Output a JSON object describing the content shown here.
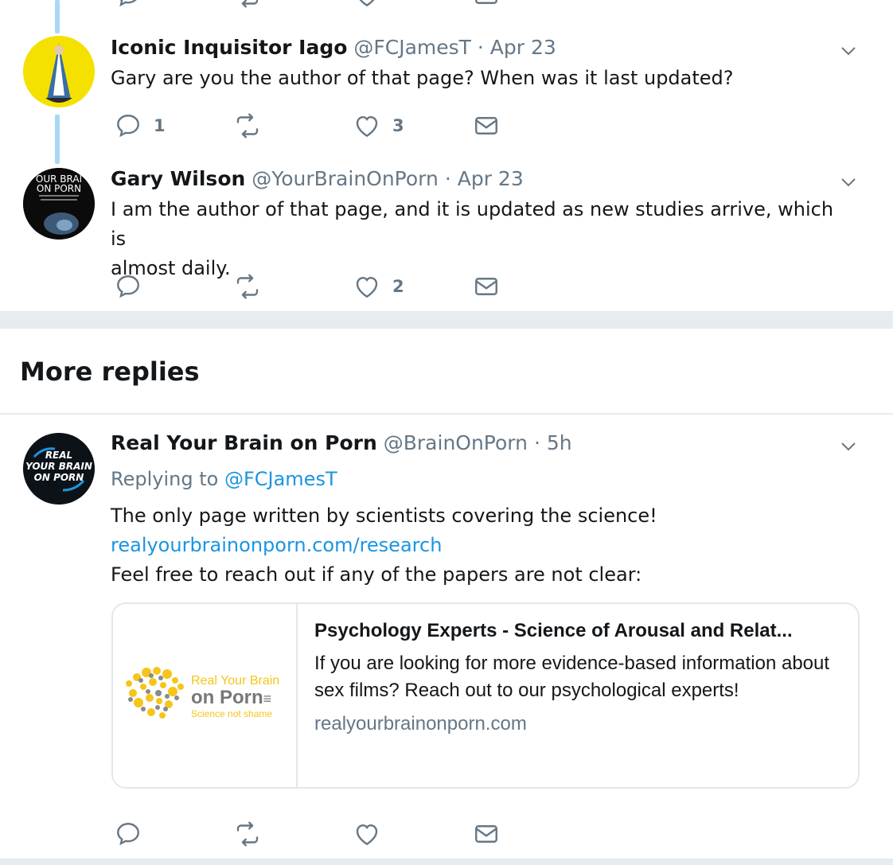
{
  "tweets": [
    {
      "name": "Iconic Inquisitor Iago",
      "handle": "@FCJamesT",
      "dot": "·",
      "time": "Apr 23",
      "text": "Gary are you the author of that page? When was it last updated?",
      "replies": "1",
      "retweets": "",
      "likes": "3"
    },
    {
      "name": "Gary Wilson",
      "handle": "@YourBrainOnPorn",
      "dot": "·",
      "time": "Apr 23",
      "text_line1": "I am the author of that page, and it is updated as new studies arrive, which is",
      "text_line2": "almost daily.",
      "avatar_text": [
        "OUR BRAI",
        "ON PORN"
      ],
      "replies": "",
      "retweets": "",
      "likes": "2"
    },
    {
      "name": "Real Your Brain on Porn",
      "handle": "@BrainOnPorn",
      "dot": "·",
      "time": "5h",
      "replying_to_label": "Replying to",
      "replying_to_handle": "@FCJamesT",
      "text_line1": "The only page written by scientists covering the science!",
      "link": "realyourbrainonporn.com/research",
      "text_line3": "Feel free to reach out if any of the papers are not clear:",
      "avatar_text": [
        "REAL",
        "YOUR BRAIN",
        "ON PORN"
      ],
      "replies": "",
      "retweets": "",
      "likes": ""
    }
  ],
  "section_title": "More replies",
  "card": {
    "title": "Psychology Experts - Science of Arousal and Relat...",
    "description": "If you are looking for more evidence-based information about sex films? Reach out to our psychological experts!",
    "domain": "realyourbrainonporn.com",
    "logo_line1": "Real Your Brain",
    "logo_line2": "on Porn",
    "logo_tagline": "Science not shame"
  },
  "colors": {
    "accent": "#1b95e0",
    "icon_gray": "#657786",
    "thread_line": "#a8d8f4",
    "separator": "#e6ecf0",
    "logo_yellow": "#f5c518",
    "logo_gray": "#8a8a8a"
  },
  "icons": [
    "reply-icon",
    "retweet-icon",
    "like-icon",
    "dm-icon",
    "caret-down-icon"
  ]
}
